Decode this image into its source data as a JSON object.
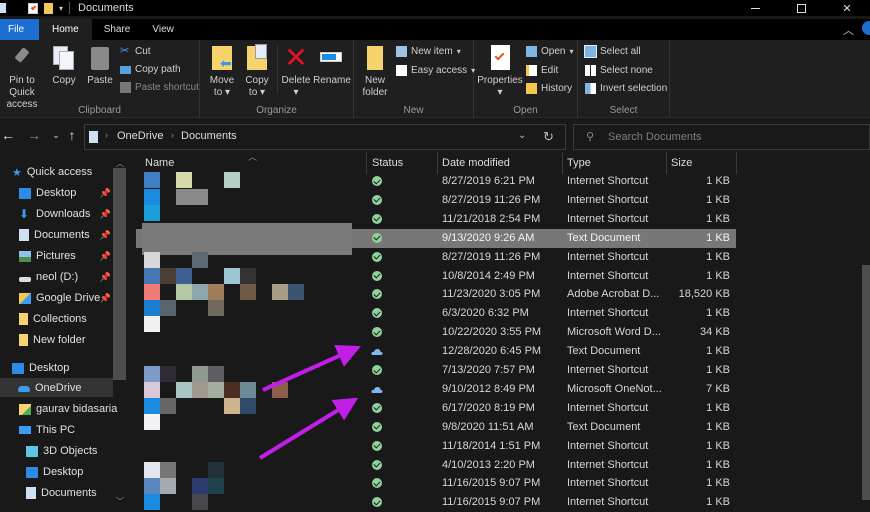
{
  "window": {
    "title": "Documents",
    "controls": {
      "minimize": "—",
      "maximize": "☐",
      "close": "✕"
    }
  },
  "ribbon_tabs": [
    {
      "label": "File"
    },
    {
      "label": "Home"
    },
    {
      "label": "Share"
    },
    {
      "label": "View"
    }
  ],
  "ribbon": {
    "clipboard": {
      "label": "Clipboard",
      "pin": "Pin to Quick access",
      "pin_line1": "Pin to Quick",
      "pin_line2": "access",
      "copy": "Copy",
      "paste": "Paste",
      "cut": "Cut",
      "copy_path": "Copy path",
      "paste_shortcut": "Paste shortcut"
    },
    "organize": {
      "label": "Organize",
      "move_to": "Move",
      "move_to2": "to",
      "copy_to": "Copy",
      "copy_to2": "to",
      "delete": "Delete",
      "rename": "Rename"
    },
    "new": {
      "label": "New",
      "new_folder1": "New",
      "new_folder2": "folder",
      "new_item": "New item",
      "easy_access": "Easy access"
    },
    "open": {
      "label": "Open",
      "properties": "Properties",
      "open": "Open",
      "edit": "Edit",
      "history": "History"
    },
    "select": {
      "label": "Select",
      "select_all": "Select all",
      "select_none": "Select none",
      "invert": "Invert selection"
    }
  },
  "navigation": {
    "breadcrumb": [
      "OneDrive",
      "Documents"
    ],
    "search_placeholder": "Search Documents"
  },
  "sidebar": {
    "quick_access": "Quick access",
    "items": [
      {
        "label": "Desktop",
        "pinned": true
      },
      {
        "label": "Downloads",
        "pinned": true
      },
      {
        "label": "Documents",
        "pinned": true
      },
      {
        "label": "Pictures",
        "pinned": true
      },
      {
        "label": "neol (D:)",
        "pinned": true
      },
      {
        "label": "Google Drive",
        "pinned": true
      },
      {
        "label": "Collections",
        "pinned": false
      },
      {
        "label": "New folder",
        "pinned": false
      }
    ],
    "tree": [
      {
        "label": "Desktop"
      },
      {
        "label": "OneDrive",
        "selected": true
      },
      {
        "label": "gaurav bidasaria"
      },
      {
        "label": "This PC"
      },
      {
        "label": "3D Objects"
      },
      {
        "label": "Desktop"
      },
      {
        "label": "Documents"
      }
    ]
  },
  "columns": {
    "name": "Name",
    "status": "Status",
    "date": "Date modified",
    "type": "Type",
    "size": "Size"
  },
  "files": [
    {
      "status": "synced",
      "date": "8/27/2019 6:21 PM",
      "type": "Internet Shortcut",
      "size": "1 KB"
    },
    {
      "status": "synced",
      "date": "8/27/2019 11:26 PM",
      "type": "Internet Shortcut",
      "size": "1 KB"
    },
    {
      "status": "synced",
      "date": "11/21/2018 2:54 PM",
      "type": "Internet Shortcut",
      "size": "1 KB"
    },
    {
      "status": "synced",
      "date": "9/13/2020 9:26 AM",
      "type": "Text Document",
      "size": "1 KB",
      "selected": true
    },
    {
      "status": "synced",
      "date": "8/27/2019 11:26 PM",
      "type": "Internet Shortcut",
      "size": "1 KB"
    },
    {
      "status": "synced",
      "date": "10/8/2014 2:49 PM",
      "type": "Internet Shortcut",
      "size": "1 KB"
    },
    {
      "status": "synced",
      "date": "11/23/2020 3:05 PM",
      "type": "Adobe Acrobat D...",
      "size": "18,520 KB"
    },
    {
      "status": "synced",
      "date": "6/3/2020 6:32 PM",
      "type": "Internet Shortcut",
      "size": "1 KB"
    },
    {
      "status": "synced",
      "date": "10/22/2020 3:55 PM",
      "type": "Microsoft Word D...",
      "size": "34 KB"
    },
    {
      "status": "cloud",
      "date": "12/28/2020 6:45 PM",
      "type": "Text Document",
      "size": "1 KB"
    },
    {
      "status": "synced",
      "date": "7/13/2020 7:57 PM",
      "type": "Internet Shortcut",
      "size": "1 KB"
    },
    {
      "status": "cloud",
      "date": "9/10/2012 8:49 PM",
      "type": "Microsoft OneNot...",
      "size": "7 KB"
    },
    {
      "status": "synced",
      "date": "6/17/2020 8:19 PM",
      "type": "Internet Shortcut",
      "size": "1 KB"
    },
    {
      "status": "synced",
      "date": "9/8/2020 11:51 AM",
      "type": "Text Document",
      "size": "1 KB"
    },
    {
      "status": "synced",
      "date": "11/18/2014 1:51 PM",
      "type": "Internet Shortcut",
      "size": "1 KB"
    },
    {
      "status": "synced",
      "date": "4/10/2013 2:20 PM",
      "type": "Internet Shortcut",
      "size": "1 KB"
    },
    {
      "status": "synced",
      "date": "11/16/2015 9:07 PM",
      "type": "Internet Shortcut",
      "size": "1 KB"
    },
    {
      "status": "synced",
      "date": "11/16/2015 9:07 PM",
      "type": "Internet Shortcut",
      "size": "1 KB"
    }
  ],
  "colors": {
    "accent": "#1a6fd0",
    "annotation_arrow": "#c21ee8",
    "synced": "#8fd19a",
    "cloud": "#7fb8f0",
    "selected_row": "#777777"
  }
}
